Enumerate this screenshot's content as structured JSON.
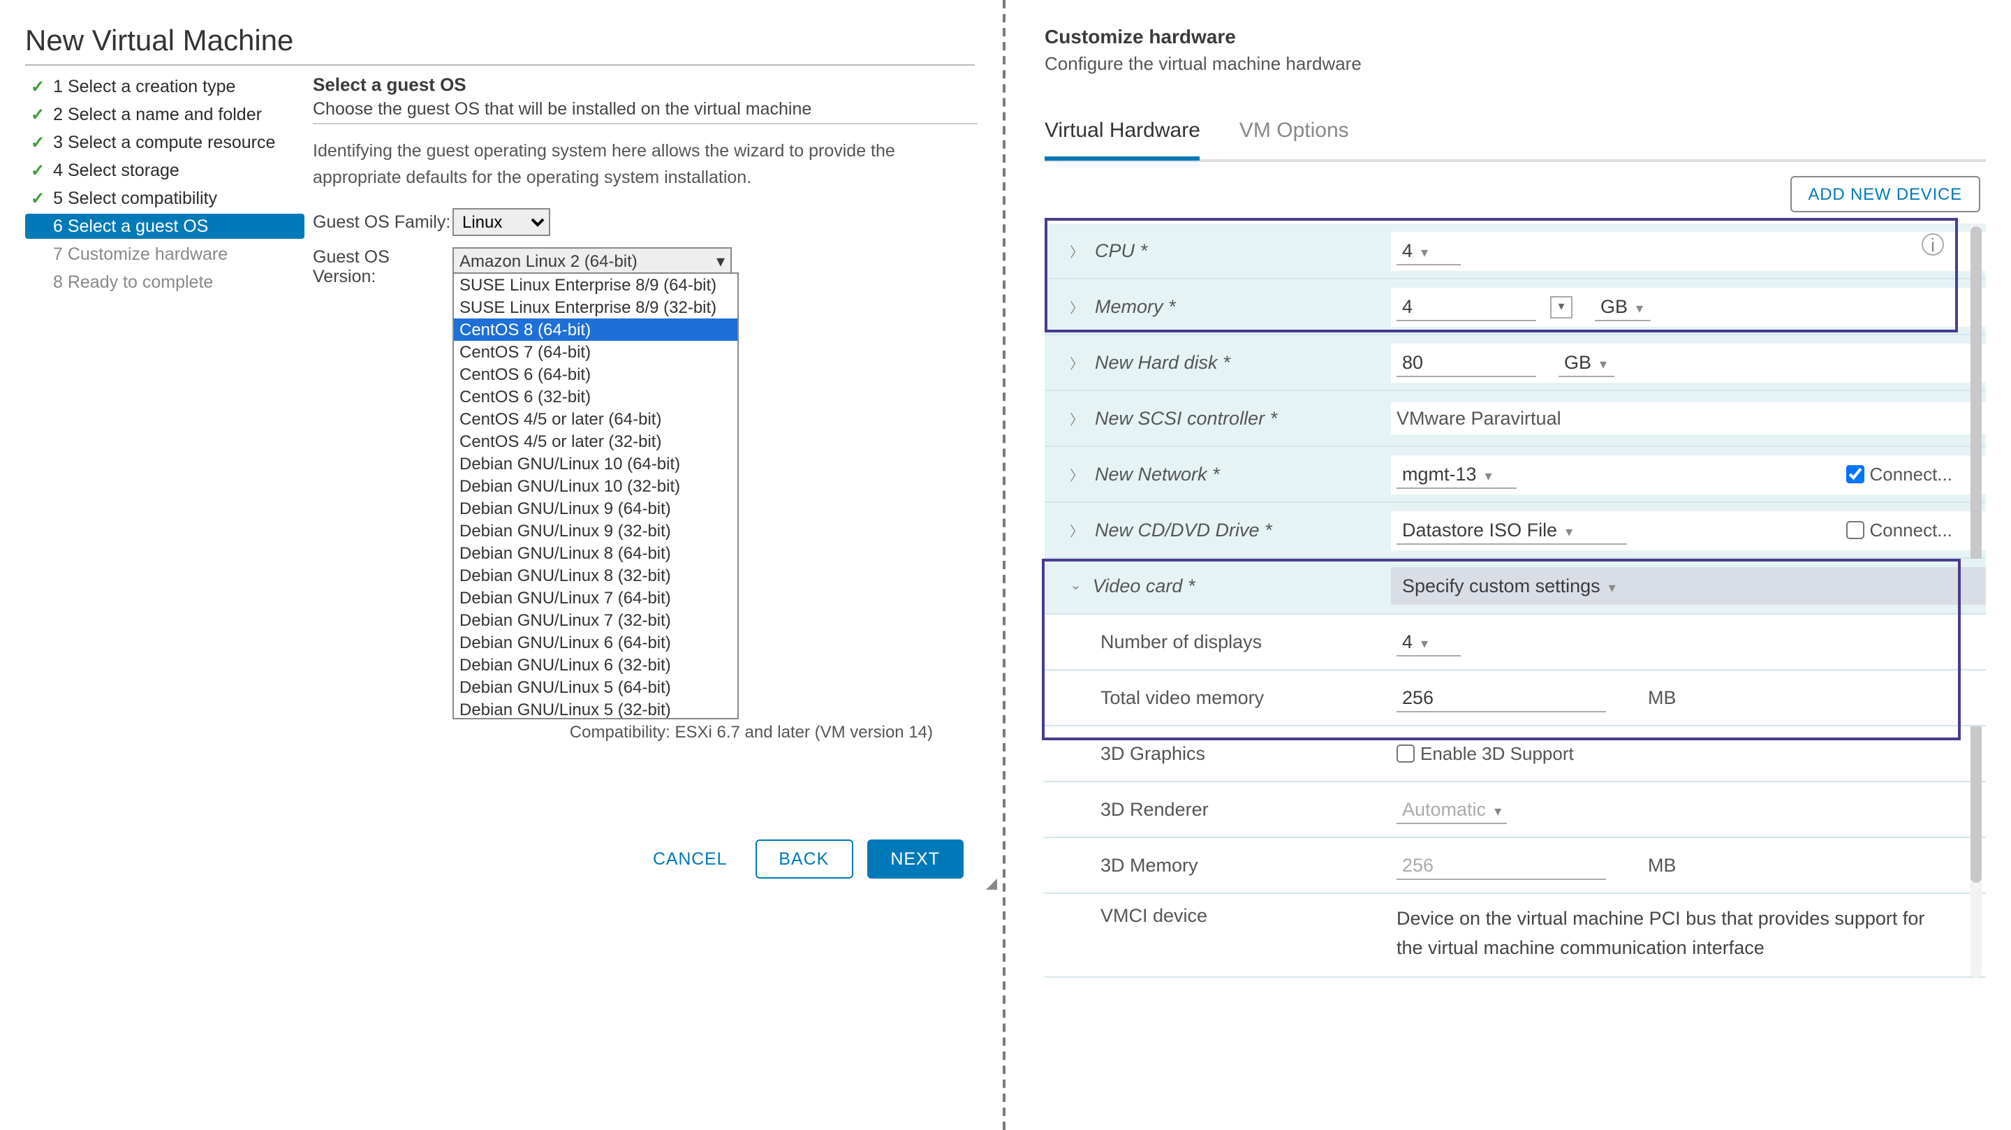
{
  "left": {
    "title": "New Virtual Machine",
    "steps": [
      {
        "num": "1",
        "label": "Select a creation type",
        "done": true
      },
      {
        "num": "2",
        "label": "Select a name and folder",
        "done": true
      },
      {
        "num": "3",
        "label": "Select a compute resource",
        "done": true
      },
      {
        "num": "4",
        "label": "Select storage",
        "done": true
      },
      {
        "num": "5",
        "label": "Select compatibility",
        "done": true
      },
      {
        "num": "6",
        "label": "Select a guest OS",
        "active": true
      },
      {
        "num": "7",
        "label": "Customize hardware",
        "pending": true
      },
      {
        "num": "8",
        "label": "Ready to complete",
        "pending": true
      }
    ],
    "section_title": "Select a guest OS",
    "section_sub": "Choose the guest OS that will be installed on the virtual machine",
    "desc": "Identifying the guest operating system here allows the wizard to provide the appropriate defaults for the operating system installation.",
    "family_label": "Guest OS Family:",
    "family_value": "Linux",
    "version_label": "Guest OS Version:",
    "version_value": "Amazon Linux 2 (64-bit)",
    "os_options": [
      "SUSE Linux Enterprise 8/9 (64-bit)",
      "SUSE Linux Enterprise 8/9 (32-bit)",
      "CentOS 8 (64-bit)",
      "CentOS 7 (64-bit)",
      "CentOS 6 (64-bit)",
      "CentOS 6 (32-bit)",
      "CentOS 4/5 or later (64-bit)",
      "CentOS 4/5 or later (32-bit)",
      "Debian GNU/Linux 10 (64-bit)",
      "Debian GNU/Linux 10 (32-bit)",
      "Debian GNU/Linux 9 (64-bit)",
      "Debian GNU/Linux 9 (32-bit)",
      "Debian GNU/Linux 8 (64-bit)",
      "Debian GNU/Linux 8 (32-bit)",
      "Debian GNU/Linux 7 (64-bit)",
      "Debian GNU/Linux 7 (32-bit)",
      "Debian GNU/Linux 6 (64-bit)",
      "Debian GNU/Linux 6 (32-bit)",
      "Debian GNU/Linux 5 (64-bit)",
      "Debian GNU/Linux 5 (32-bit)"
    ],
    "os_selected_index": 2,
    "compat": "Compatibility: ESXi 6.7 and later (VM version 14)",
    "btn_cancel": "CANCEL",
    "btn_back": "BACK",
    "btn_next": "NEXT"
  },
  "right": {
    "title": "Customize hardware",
    "sub": "Configure the virtual machine hardware",
    "tabs": [
      "Virtual Hardware",
      "VM Options"
    ],
    "active_tab": 0,
    "add_device": "ADD NEW DEVICE",
    "rows": {
      "cpu": {
        "label": "CPU *",
        "value": "4"
      },
      "memory": {
        "label": "Memory *",
        "value": "4",
        "unit": "GB"
      },
      "disk": {
        "label": "New Hard disk *",
        "value": "80",
        "unit": "GB"
      },
      "scsi": {
        "label": "New SCSI controller *",
        "value": "VMware Paravirtual"
      },
      "network": {
        "label": "New Network *",
        "value": "mgmt-13",
        "connect": "Connect...",
        "checked": true
      },
      "cddvd": {
        "label": "New CD/DVD Drive *",
        "value": "Datastore ISO File",
        "connect": "Connect...",
        "checked": false
      },
      "video": {
        "label": "Video card *",
        "value": "Specify custom settings"
      },
      "displays": {
        "label": "Number of displays",
        "value": "4"
      },
      "vmem": {
        "label": "Total video memory",
        "value": "256",
        "unit": "MB"
      },
      "gfx3d": {
        "label": "3D Graphics",
        "checkbox": "Enable 3D Support"
      },
      "renderer": {
        "label": "3D Renderer",
        "value": "Automatic"
      },
      "mem3d": {
        "label": "3D Memory",
        "value": "256",
        "unit": "MB"
      },
      "vmci": {
        "label": "VMCI device",
        "desc": "Device on the virtual machine PCI bus that provides support for the virtual machine communication interface"
      }
    }
  }
}
